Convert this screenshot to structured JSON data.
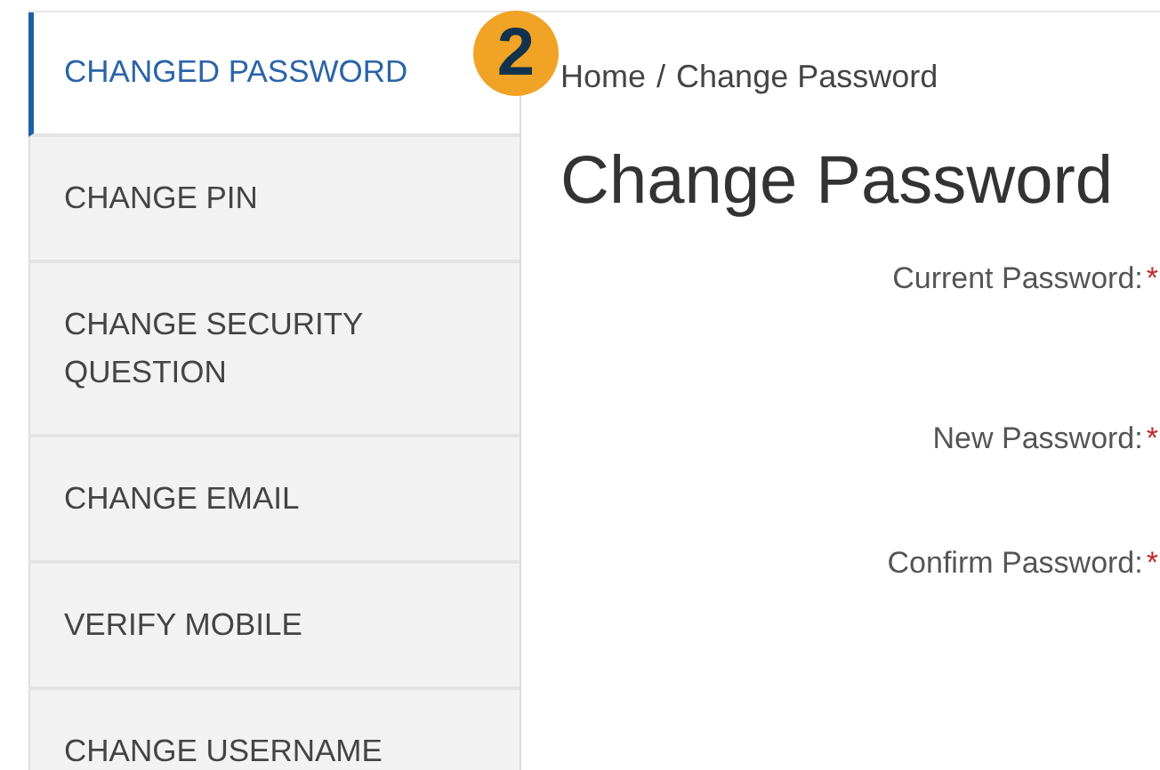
{
  "sidebar": {
    "items": [
      {
        "label": "CHANGED PASSWORD",
        "selected": true
      },
      {
        "label": "CHANGE PIN",
        "selected": false
      },
      {
        "label": "CHANGE SECURITY QUESTION",
        "selected": false
      },
      {
        "label": "CHANGE EMAIL",
        "selected": false
      },
      {
        "label": "VERIFY MOBILE",
        "selected": false
      },
      {
        "label": "CHANGE USERNAME",
        "selected": false
      }
    ]
  },
  "step_badge": "2",
  "breadcrumb": {
    "items": [
      "Home",
      "Change Password"
    ],
    "separator": "/"
  },
  "title": "Change Password",
  "form": {
    "fields": [
      {
        "label": "Current Password:",
        "required_mark": "*"
      },
      {
        "label": "New Password:",
        "required_mark": "*"
      },
      {
        "label": "Confirm Password:",
        "required_mark": "*"
      }
    ]
  }
}
